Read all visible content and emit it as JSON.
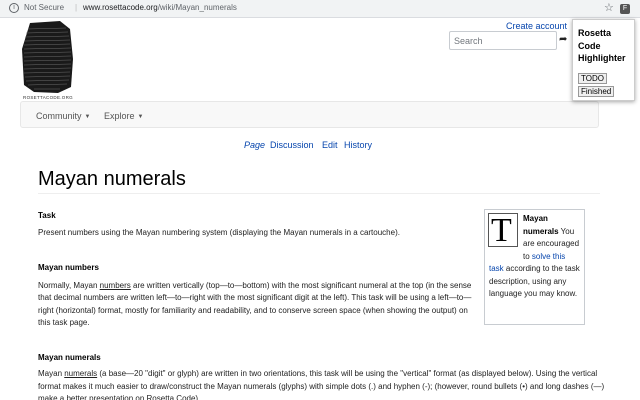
{
  "browser": {
    "security_label": "Not Secure",
    "url_host": "www.rosettacode.org",
    "url_path": "/wiki/Mayan_numerals"
  },
  "site": {
    "logo_text": "ROSETTACODE.ORG",
    "create_account": "Create account",
    "search_placeholder": "Search"
  },
  "nav": {
    "items": [
      {
        "label": "Community"
      },
      {
        "label": "Explore"
      }
    ]
  },
  "tabs": [
    "Page",
    "Discussion",
    "Edit",
    "History"
  ],
  "article": {
    "title": "Mayan numerals",
    "task_heading": "Task",
    "task_text": "Present numbers using the Mayan numbering system   (displaying the Mayan numerals in a cartouche).",
    "section1_heading": "Mayan numbers",
    "section1_pre": "Normally, Mayan ",
    "section1_link": "numbers",
    "section1_post": " are written vertically   (top—to—bottom)   with the most significant numeral at the top   (in the sense that decimal numbers are written left—to—right with the most significant digit at the left).   This task will be using a left—to—right (horizontal) format,   mostly for familiarity and readability,   and to conserve screen space (when showing the output) on this task page.",
    "section2_heading": "Mayan numerals",
    "section2_pre": "Mayan ",
    "section2_link": "numerals",
    "section2_post": "   (a base—20 \"digit\" or glyph)   are written in two orientations,   this task will be using the \"vertical\" format   (as displayed below).   Using the vertical format makes it much easier to draw/construct the Mayan numerals (glyphs) with simple dots (.) and hyphen (-);   (however, round bullets (•) and long dashes (—) make a better presentation on Rosetta Code)."
  },
  "infobox": {
    "glyph": "T",
    "title": "Mayan numerals",
    "text1": " You are encouraged to ",
    "link": "solve this task",
    "text2": " according to the task description, using any language you may know."
  },
  "extension_popup": {
    "title": "Rosetta Code Highlighter",
    "todo_label": "TODO",
    "finished_label": "Finished"
  }
}
